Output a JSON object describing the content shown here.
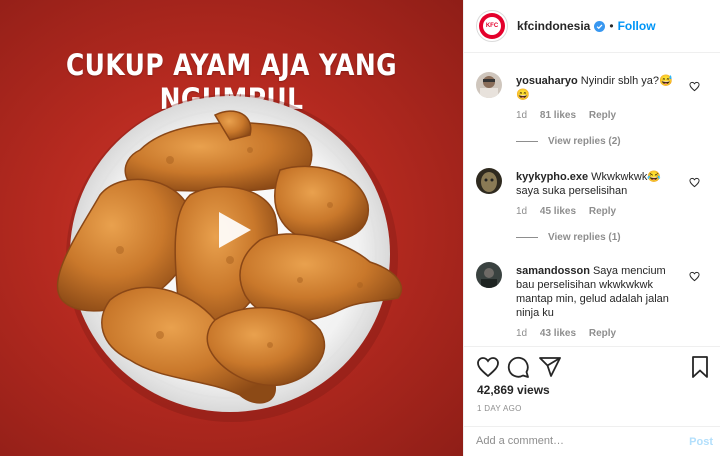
{
  "media": {
    "headline": "CUKUP AYAM AJA YANG NGUMPUL"
  },
  "header": {
    "avatar_text": "KFC",
    "username": "kfcindonesia",
    "separator": "•",
    "follow_label": "Follow"
  },
  "comments": [
    {
      "username": "yosuaharyo",
      "text": "Nyindir sblh ya?😅😄",
      "time": "1d",
      "likes": "81 likes",
      "reply_label": "Reply",
      "view_replies": "View replies (2)"
    },
    {
      "username": "kyykypho.exe",
      "text": "Wkwkwkwk😂 saya suka perselisihan",
      "time": "1d",
      "likes": "45 likes",
      "reply_label": "Reply",
      "view_replies": "View replies (1)"
    },
    {
      "username": "samandosson",
      "text": "Saya mencium bau perselisihan wkwkwkwk mantap min, gelud adalah jalan ninja ku",
      "time": "1d",
      "likes": "43 likes",
      "reply_label": "Reply"
    }
  ],
  "stats": {
    "views": "42,869 views",
    "time_ago": "1 DAY AGO"
  },
  "add_comment": {
    "placeholder": "Add a comment…",
    "post_label": "Post"
  },
  "colors": {
    "brand_red": "#e4002b",
    "link_blue": "#0095f6",
    "background_red": "#b62a20"
  },
  "icons": [
    "kfc-logo",
    "verified-badge-icon",
    "play-icon",
    "heart-icon",
    "comment-icon",
    "share-icon",
    "bookmark-icon"
  ]
}
